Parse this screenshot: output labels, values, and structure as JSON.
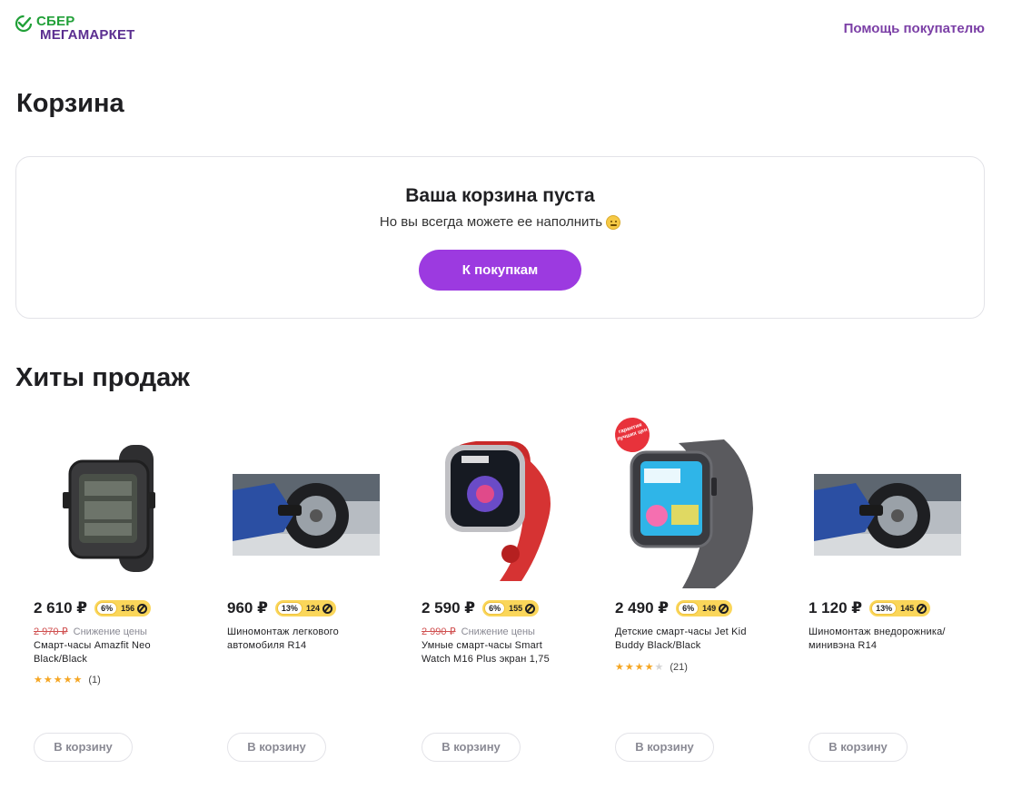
{
  "header": {
    "logo_line1": "СБЕР",
    "logo_line2": "МЕГАМАРКЕТ",
    "help_link": "Помощь покупателю"
  },
  "page_title": "Корзина",
  "empty_cart": {
    "title": "Ваша корзина пуста",
    "subtitle": "Но вы всегда можете ее наполнить",
    "button": "К покупкам"
  },
  "section_title": "Хиты продаж",
  "colors": {
    "accent_purple": "#9c3ae0",
    "brand_green": "#21a038",
    "brand_purple": "#5b2e90",
    "bonus_yellow": "#fad65a"
  },
  "products": [
    {
      "image": "smartwatch-black-icon",
      "price": "2 610 ₽",
      "bonus_pct": "6%",
      "bonus_points": "156",
      "old_price": "2 970 ₽",
      "discount_label": "Снижение цены",
      "name_line1": "Смарт-часы Amazfit Neo",
      "name_line2": "Black/Black",
      "rating": 5,
      "reviews": "(1)",
      "cart_button": "В корзину"
    },
    {
      "image": "tire-service-icon",
      "price": "960 ₽",
      "bonus_pct": "13%",
      "bonus_points": "124",
      "old_price": "",
      "discount_label": "",
      "name_line1": "Шиномонтаж легкового",
      "name_line2": "автомобиля R14",
      "rating": null,
      "reviews": "",
      "cart_button": "В корзину"
    },
    {
      "image": "smartwatch-red-icon",
      "price": "2 590 ₽",
      "bonus_pct": "6%",
      "bonus_points": "155",
      "old_price": "2 990 ₽",
      "discount_label": "Снижение цены",
      "name_line1": "Умные смарт-часы Smart",
      "name_line2": "Watch M16 Plus экран 1,75",
      "rating": null,
      "reviews": "",
      "cart_button": "В корзину"
    },
    {
      "image": "kids-smartwatch-icon",
      "badge": "гарантия лучших цен",
      "price": "2 490 ₽",
      "bonus_pct": "6%",
      "bonus_points": "149",
      "old_price": "",
      "discount_label": "",
      "name_line1": "Детские смарт-часы Jet Kid",
      "name_line2": "Buddy Black/Black",
      "rating": 4,
      "reviews": "(21)",
      "cart_button": "В корзину"
    },
    {
      "image": "tire-service-icon",
      "price": "1 120 ₽",
      "bonus_pct": "13%",
      "bonus_points": "145",
      "old_price": "",
      "discount_label": "",
      "name_line1": "Шиномонтаж внедорожника/",
      "name_line2": "минивэна R14",
      "rating": null,
      "reviews": "",
      "cart_button": "В корзину"
    }
  ]
}
